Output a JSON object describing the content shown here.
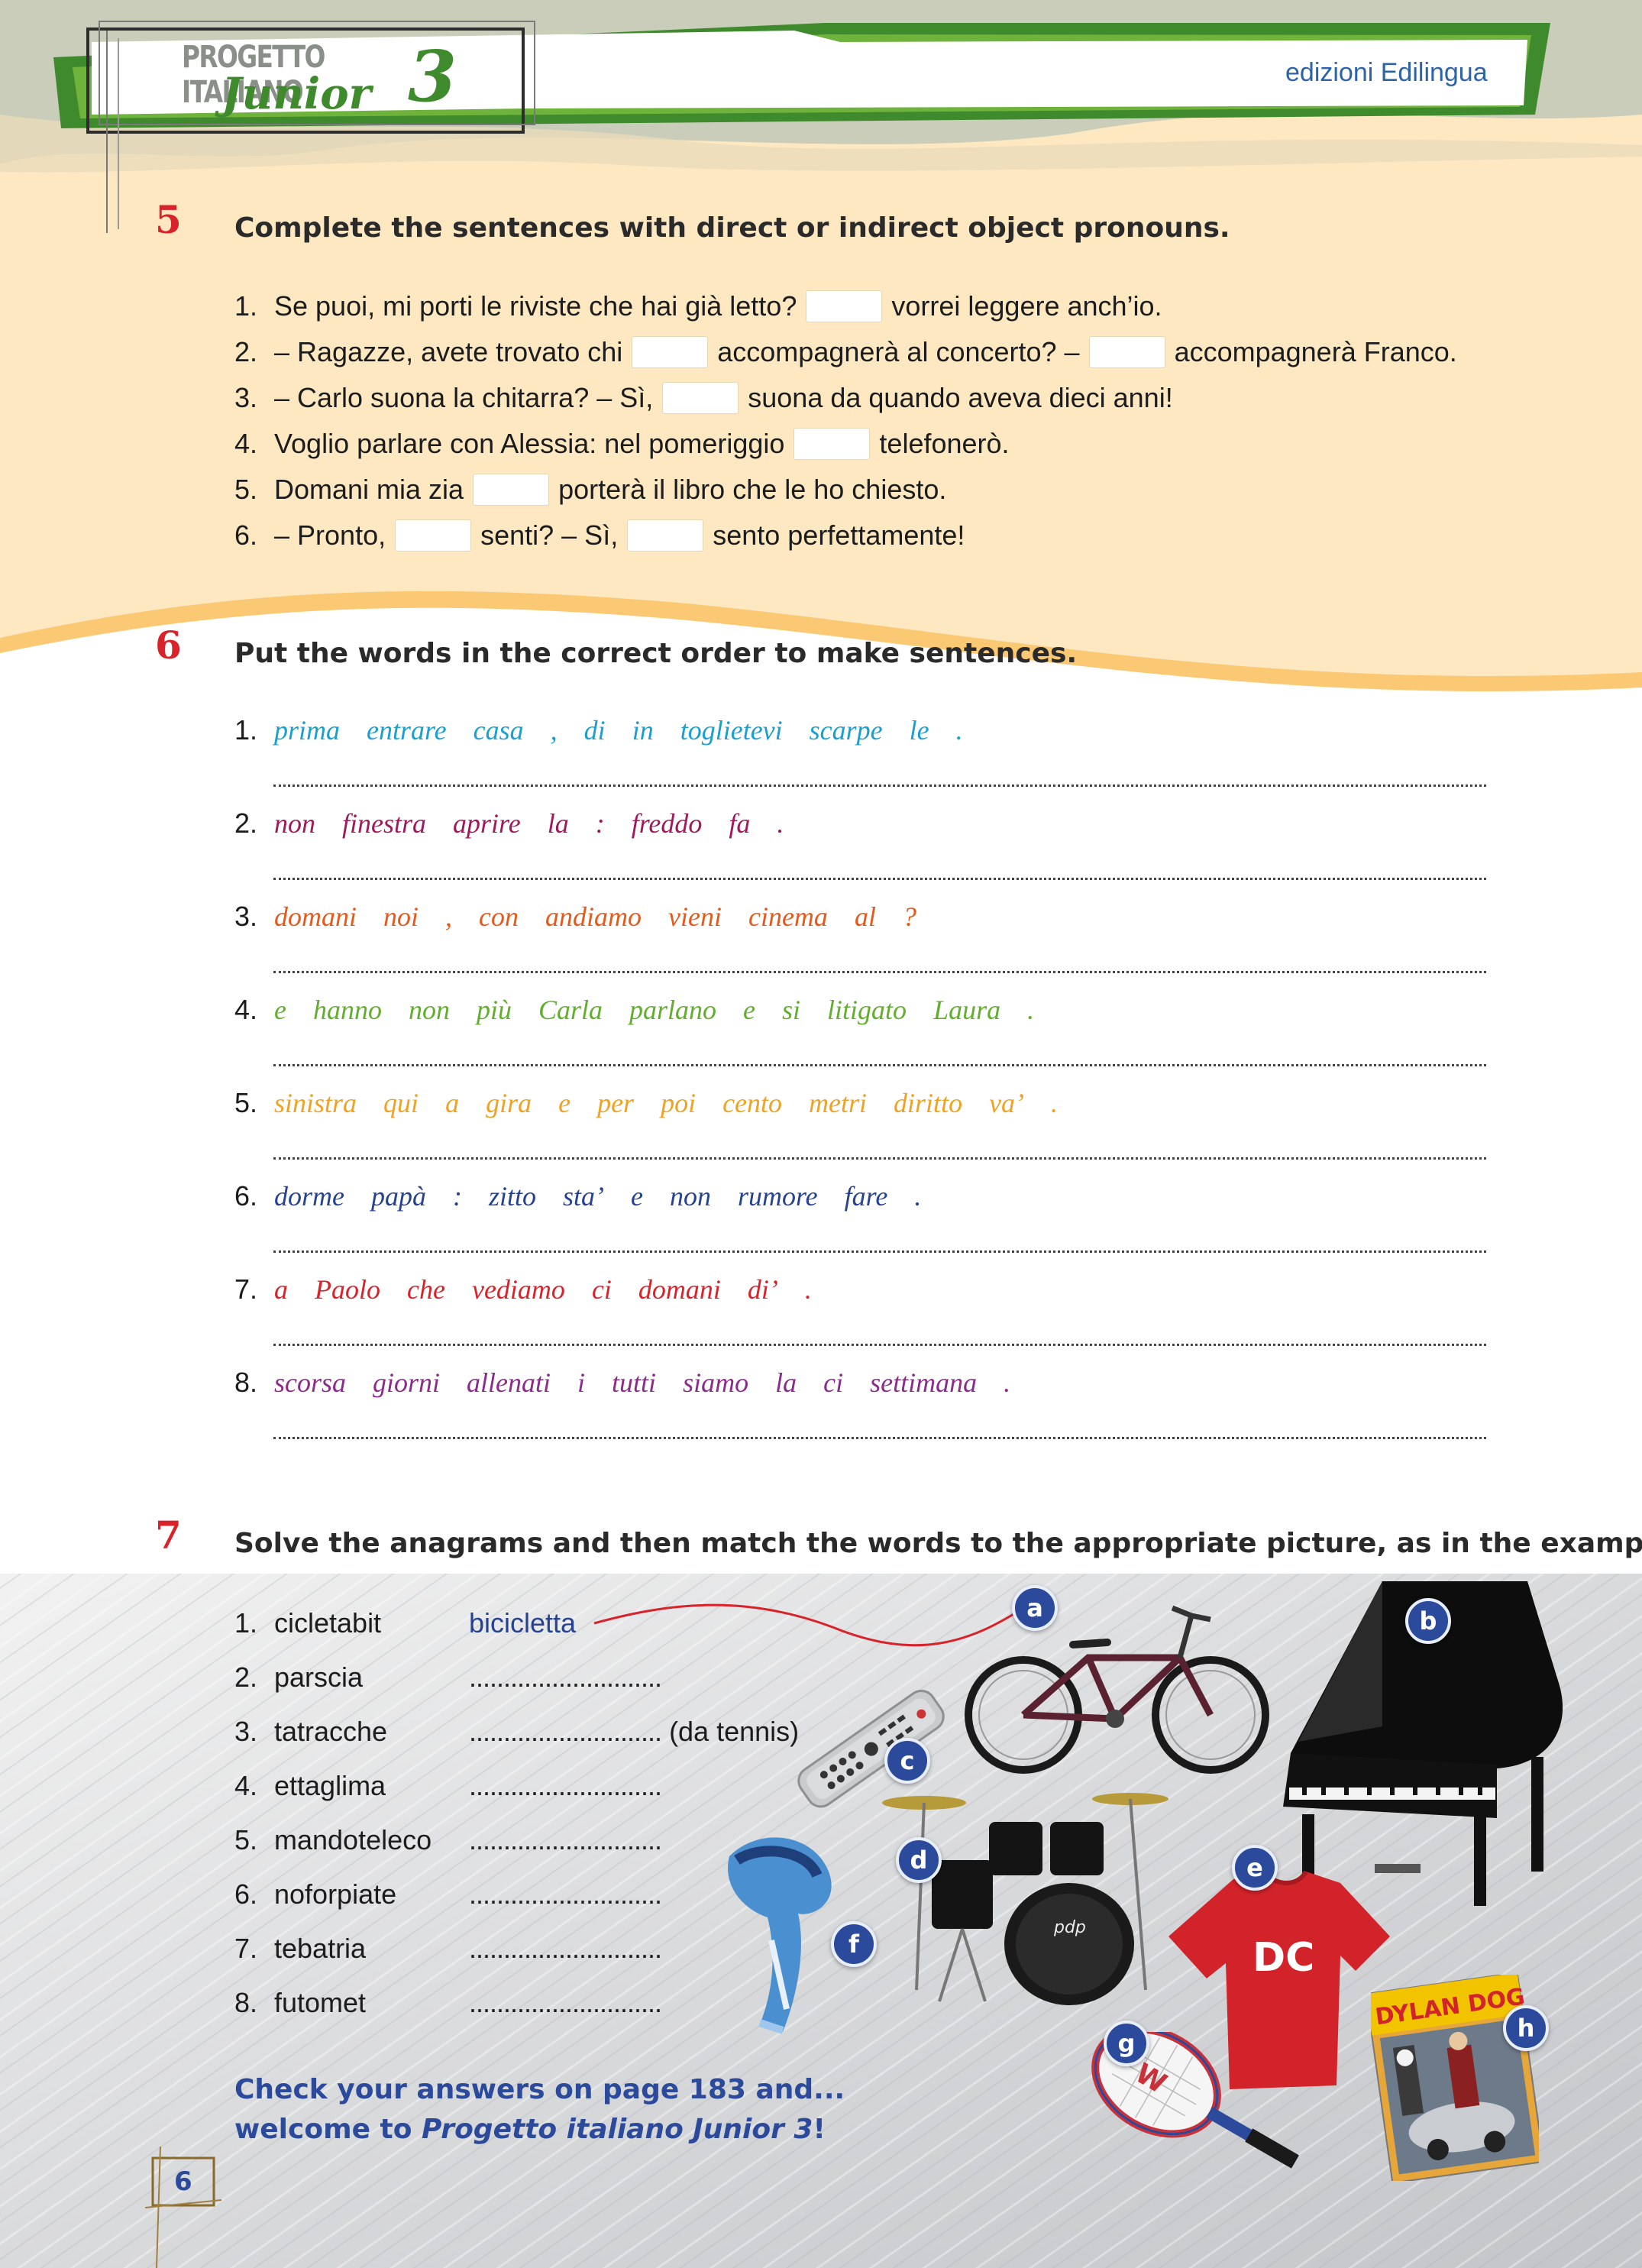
{
  "header": {
    "logo_line1": "PROGETTO ITALIANO",
    "logo_line2": "Junior",
    "logo_number": "3",
    "publisher": "edizioni Edilingua"
  },
  "ex5": {
    "number": "5",
    "instruction": "Complete the sentences with direct or indirect object pronouns.",
    "items": [
      {
        "n": "1.",
        "parts": [
          "Se puoi, mi porti le riviste che hai già letto?",
          "vorrei leggere anch’io."
        ]
      },
      {
        "n": "2.",
        "parts": [
          "– Ragazze, avete trovato chi",
          "accompagnerà al concerto? –",
          "accompagnerà Franco."
        ]
      },
      {
        "n": "3.",
        "parts": [
          "– Carlo suona la chitarra? – Sì,",
          "suona da quando aveva dieci anni!"
        ]
      },
      {
        "n": "4.",
        "parts": [
          "Voglio parlare con Alessia: nel pomeriggio",
          "telefonerò."
        ]
      },
      {
        "n": "5.",
        "parts": [
          "Domani mia zia",
          "porterà il libro che le ho chiesto."
        ]
      },
      {
        "n": "6.",
        "parts": [
          "– Pronto,",
          "senti? – Sì,",
          "sento perfettamente!"
        ]
      }
    ]
  },
  "ex6": {
    "number": "6",
    "instruction": "Put the words in the correct order to make sentences.",
    "items": [
      {
        "n": "1.",
        "color": "#1a9fce",
        "words": [
          "prima",
          "entrare",
          "casa",
          ",",
          "di",
          "in",
          "toglietevi",
          "scarpe",
          "le",
          "."
        ]
      },
      {
        "n": "2.",
        "color": "#a0195a",
        "words": [
          "non",
          "finestra",
          "aprire",
          "la",
          ":",
          "freddo",
          "fa",
          "."
        ]
      },
      {
        "n": "3.",
        "color": "#e55a1c",
        "words": [
          "domani",
          "noi",
          ",",
          "con",
          "andiamo",
          "vieni",
          "cinema",
          "al",
          "?"
        ]
      },
      {
        "n": "4.",
        "color": "#63ae2e",
        "words": [
          "e",
          "hanno",
          "non",
          "più",
          "Carla",
          "parlano",
          "e",
          "si",
          "litigato",
          "Laura",
          "."
        ]
      },
      {
        "n": "5.",
        "color": "#eea324",
        "words": [
          "sinistra",
          "qui",
          "a",
          "gira",
          "e",
          "per",
          "poi",
          "cento",
          "metri",
          "diritto",
          "va’",
          "."
        ]
      },
      {
        "n": "6.",
        "color": "#27438f",
        "words": [
          "dorme",
          "papà",
          ":",
          "zitto",
          "sta’",
          "e",
          "non",
          "rumore",
          "fare",
          "."
        ]
      },
      {
        "n": "7.",
        "color": "#d8232a",
        "words": [
          "a",
          "Paolo",
          "che",
          "vediamo",
          "ci",
          "domani",
          "di’",
          "."
        ]
      },
      {
        "n": "8.",
        "color": "#8b2c8a",
        "words": [
          "scorsa",
          "giorni",
          "allenati",
          "i",
          "tutti",
          "siamo",
          "la",
          "ci",
          "settimana",
          "."
        ]
      }
    ]
  },
  "ex7": {
    "number": "7",
    "instruction": "Solve the anagrams and then match the words to the appropriate picture, as in the example.",
    "example_answer": "bicicletta",
    "dots": "............................",
    "items": [
      {
        "n": "1.",
        "word": "cicletabit",
        "suffix": ""
      },
      {
        "n": "2.",
        "word": "parscia",
        "suffix": ""
      },
      {
        "n": "3.",
        "word": "tatracche",
        "suffix": "(da tennis)"
      },
      {
        "n": "4.",
        "word": "ettaglima",
        "suffix": ""
      },
      {
        "n": "5.",
        "word": "mandoteleco",
        "suffix": ""
      },
      {
        "n": "6.",
        "word": "noforpiate",
        "suffix": ""
      },
      {
        "n": "7.",
        "word": "tebatria",
        "suffix": ""
      },
      {
        "n": "8.",
        "word": "futomet",
        "suffix": ""
      }
    ],
    "badges": [
      "a",
      "b",
      "c",
      "d",
      "e",
      "f",
      "g",
      "h"
    ],
    "comic_title": "DYLAN DOG",
    "shirt_logo": "DC",
    "drum_logo": "pdp"
  },
  "footer": {
    "check_line1": "Check your answers on page 183 and...",
    "check_line2_pre": "welcome to ",
    "check_line2_italic": "Progetto italiano Junior 3",
    "check_line2_post": "!",
    "page_number": "6"
  },
  "colors": {
    "cream": "#fde8c2",
    "green": "#5a9e3a",
    "accent_red": "#d8232a",
    "badge_blue": "#2b4a9b",
    "publisher_blue": "#2f63a8"
  }
}
